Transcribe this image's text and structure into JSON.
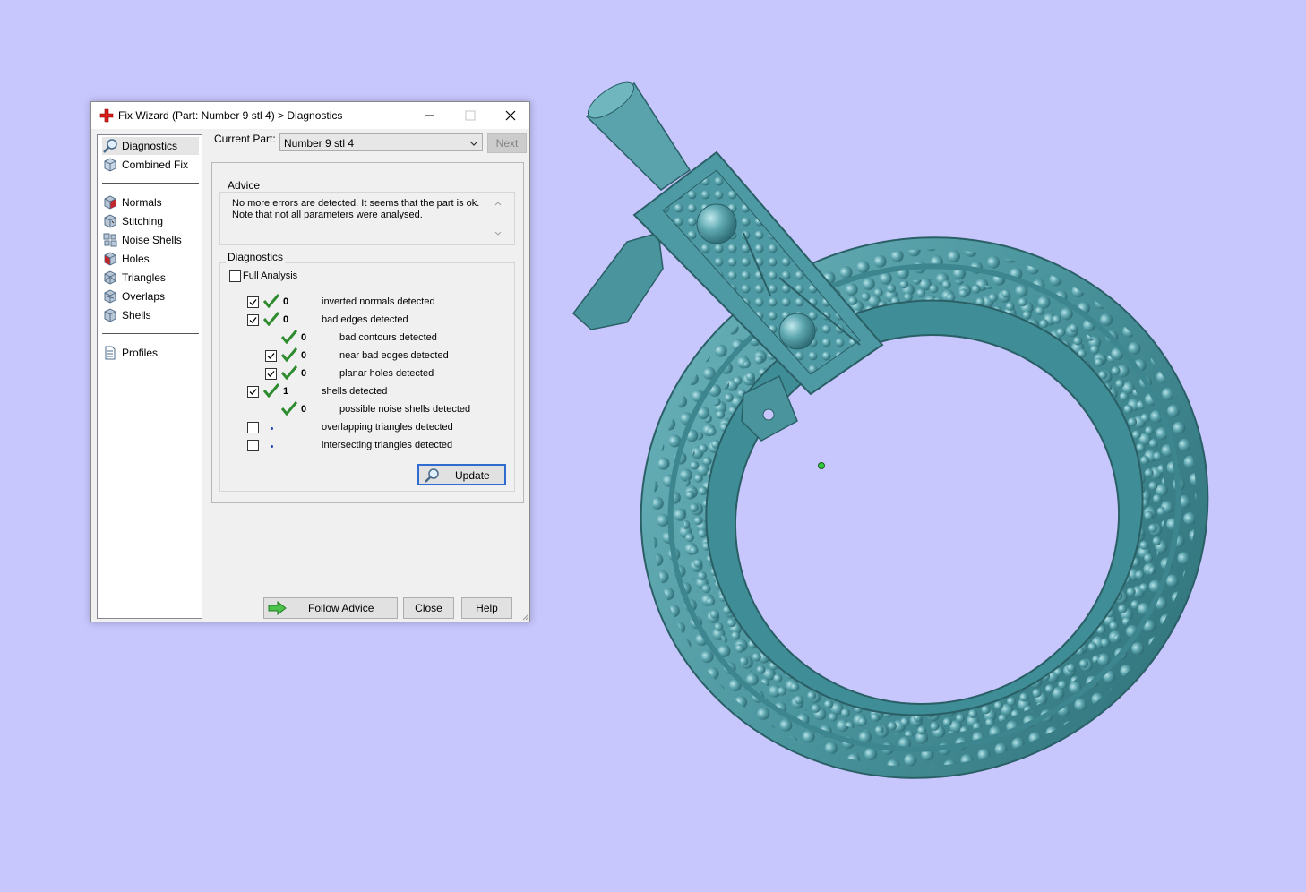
{
  "window": {
    "title": "Fix Wizard (Part: Number 9 stl 4) > Diagnostics",
    "minimize_icon": "minimize-icon",
    "maximize_icon": "maximize-icon",
    "close_icon": "close-icon"
  },
  "nav": {
    "groups": [
      [
        {
          "label": "Diagnostics",
          "icon": "magnifier-icon",
          "selected": true
        },
        {
          "label": "Combined Fix",
          "icon": "cube-icon"
        }
      ],
      [
        {
          "label": "Normals",
          "icon": "normals-cube-icon"
        },
        {
          "label": "Stitching",
          "icon": "stitching-cube-icon"
        },
        {
          "label": "Noise Shells",
          "icon": "noise-shells-icon"
        },
        {
          "label": "Holes",
          "icon": "holes-cube-icon"
        },
        {
          "label": "Triangles",
          "icon": "triangles-cube-icon"
        },
        {
          "label": "Overlaps",
          "icon": "overlaps-cube-icon"
        },
        {
          "label": "Shells",
          "icon": "shells-cube-icon"
        }
      ],
      [
        {
          "label": "Profiles",
          "icon": "document-icon"
        }
      ]
    ]
  },
  "current_part": {
    "label": "Current Part:",
    "value": "Number 9 stl 4",
    "next_label": "Next"
  },
  "advice": {
    "title": "Advice",
    "line1": "No more errors are detected. It seems that the part is ok.",
    "line2": "Note that not all parameters were analysed."
  },
  "diagnostics": {
    "title": "Diagnostics",
    "full_analysis_label": "Full Analysis",
    "full_analysis_checked": false,
    "rows": [
      {
        "label": "inverted normals detected",
        "count": "0",
        "checked": true,
        "status": "ok"
      },
      {
        "label": "bad edges detected",
        "count": "0",
        "checked": true,
        "status": "ok"
      },
      {
        "label": "bad contours detected",
        "count": "0",
        "status": "ok"
      },
      {
        "label": "near bad edges detected",
        "count": "0",
        "checked": true,
        "status": "ok"
      },
      {
        "label": "planar holes detected",
        "count": "0",
        "checked": true,
        "status": "ok"
      },
      {
        "label": "shells detected",
        "count": "1",
        "checked": true,
        "status": "ok"
      },
      {
        "label": "possible noise shells detected",
        "count": "0",
        "status": "ok"
      },
      {
        "label": "overlapping triangles detected",
        "count": "",
        "checked": false,
        "status": "not-analysed"
      },
      {
        "label": "intersecting triangles detected",
        "count": "",
        "checked": false,
        "status": "not-analysed"
      }
    ],
    "update_label": "Update"
  },
  "footer": {
    "follow_advice_label": "Follow Advice",
    "close_label": "Close",
    "help_label": "Help"
  },
  "colors": {
    "viewport_bg": "#c7c6fd",
    "model": "#4e9aa4",
    "check_ok": "#2e8b2e"
  }
}
